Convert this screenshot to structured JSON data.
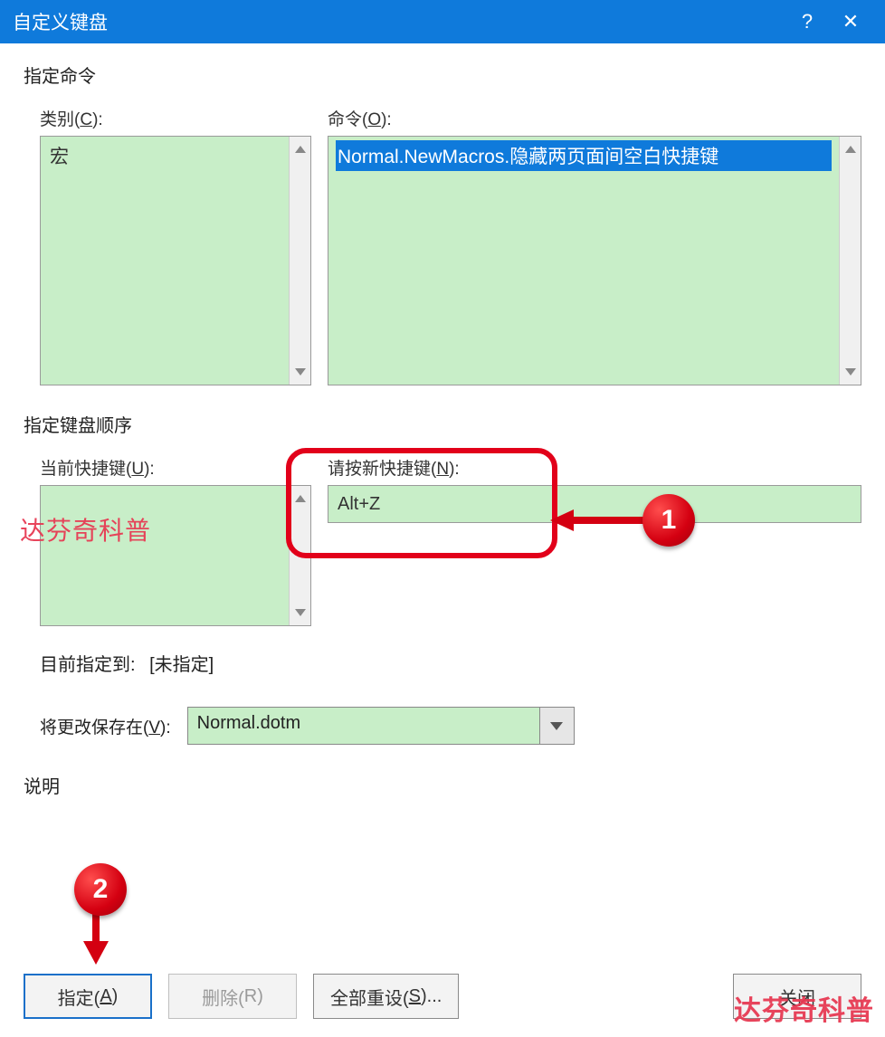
{
  "titlebar": {
    "title": "自定义键盘",
    "help": "?",
    "close": "✕"
  },
  "section": {
    "specify_command": "指定命令",
    "specify_sequence": "指定键盘顺序",
    "description": "说明"
  },
  "labels": {
    "category_prefix": "类别(",
    "category_key": "C",
    "category_suffix": "):",
    "commands_prefix": "命令(",
    "commands_key": "O",
    "commands_suffix": "):",
    "current_keys_prefix": "当前快捷键(",
    "current_keys_key": "U",
    "current_keys_suffix": "):",
    "new_key_prefix": "请按新快捷键(",
    "new_key_key": "N",
    "new_key_suffix": "):",
    "assigned_to": "目前指定到:",
    "assigned_value": "[未指定]",
    "save_in_prefix": "将更改保存在(",
    "save_in_key": "V",
    "save_in_suffix": "):"
  },
  "category": {
    "items": [
      "宏"
    ]
  },
  "commands": {
    "items": [
      "Normal.NewMacros.隐藏两页面间空白快捷键"
    ],
    "selected_index": 0
  },
  "new_key_value": "Alt+Z",
  "save_in_value": "Normal.dotm",
  "buttons": {
    "assign_prefix": "指定(",
    "assign_key": "A",
    "assign_suffix": ")",
    "remove_prefix": "删除(",
    "remove_key": "R",
    "remove_suffix": ")",
    "reset_prefix": "全部重设(",
    "reset_key": "S",
    "reset_suffix": ")...",
    "close": "关闭"
  },
  "callouts": {
    "one": "1",
    "two": "2"
  },
  "watermark": "达芬奇科普"
}
